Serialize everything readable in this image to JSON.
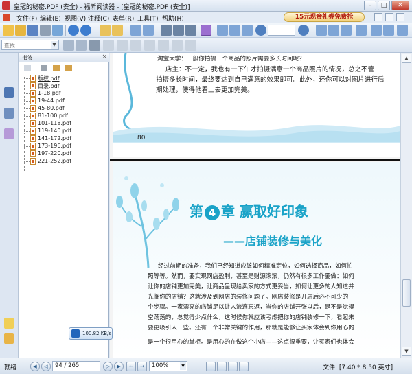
{
  "window": {
    "title": "皇冠的秘密.PDF (安全) - 福昕阅读器 - [皇冠的秘密.PDF (安全)]",
    "minimize": "–",
    "maximize": "□",
    "close": "✕"
  },
  "menu": {
    "file": "文件(F)",
    "edit": "编辑(E)",
    "view": "视图(V)",
    "comment": "注释(C)",
    "form": "表单(R)",
    "tools": "工具(T)",
    "help": "帮助(H)",
    "promo": "15元现金礼券免费抢"
  },
  "search": {
    "placeholder": "查找:"
  },
  "bookmarks": {
    "header": "书签",
    "close": "×",
    "items": [
      "版权.pdf",
      "目录.pdf",
      "1-18.pdf",
      "19-44.pdf",
      "45-80.pdf",
      "81-100.pdf",
      "101-118.pdf",
      "119-140.pdf",
      "141-172.pdf",
      "173-196.pdf",
      "197-220.pdf",
      "221-252.pdf"
    ]
  },
  "page1": {
    "line1": "淘宝大学：一般你拍摄一个商品的照片需要多长时间呢？",
    "line2": "店主：不一定，我也有一下午才拍摄满意一个商品照片的情况，总之不管",
    "line3": "拍摄多长时间，最终要达到自己满意的效果即可。此外，还你可以对图片进行后",
    "line4": "期处理，使得他看上去更加完美。",
    "page_number": "80"
  },
  "page2": {
    "chapter_prefix": "第",
    "chapter_number": "4",
    "chapter_suffix": "章  赢取好印象",
    "subtitle": "——店铺装修与美化",
    "lines": [
      "经过前期的准备，我们已经知道应该如何精准定位，如何选择商品，如何拍",
      "照等等。然而，要实现网店盈利，甚至是财源滚滚，仍然有很多工作要做：如何",
      "让你的店铺更加完美，让商品呈现给卖家的方式更妥当，如何让更多的人知道并",
      "光临你的店铺？这就涉及到网店的装修问题了。网店装修是开店后必不可少的一",
      "个步骤。一家漂亮的店铺足以让人流连忘返，当你的店铺开张以后，是不是觉得",
      "空荡荡的，总觉得少点什么，这时候你就应该考虑把你的店铺装修一下，看起来",
      "要更吸引人一些。还有一个非常关键的作用，那就是能够让买家体会到你用心的",
      "是一个很用心的掌柜。是用心的在做这个小店——这点很重要，让买家们也体会"
    ]
  },
  "speed": {
    "text": "100.82 KB/s"
  },
  "status": {
    "ready": "就绪",
    "page": "94 / 265",
    "zoom": "100%",
    "filesize": "文件: [7.40 * 8.50 英寸]"
  }
}
